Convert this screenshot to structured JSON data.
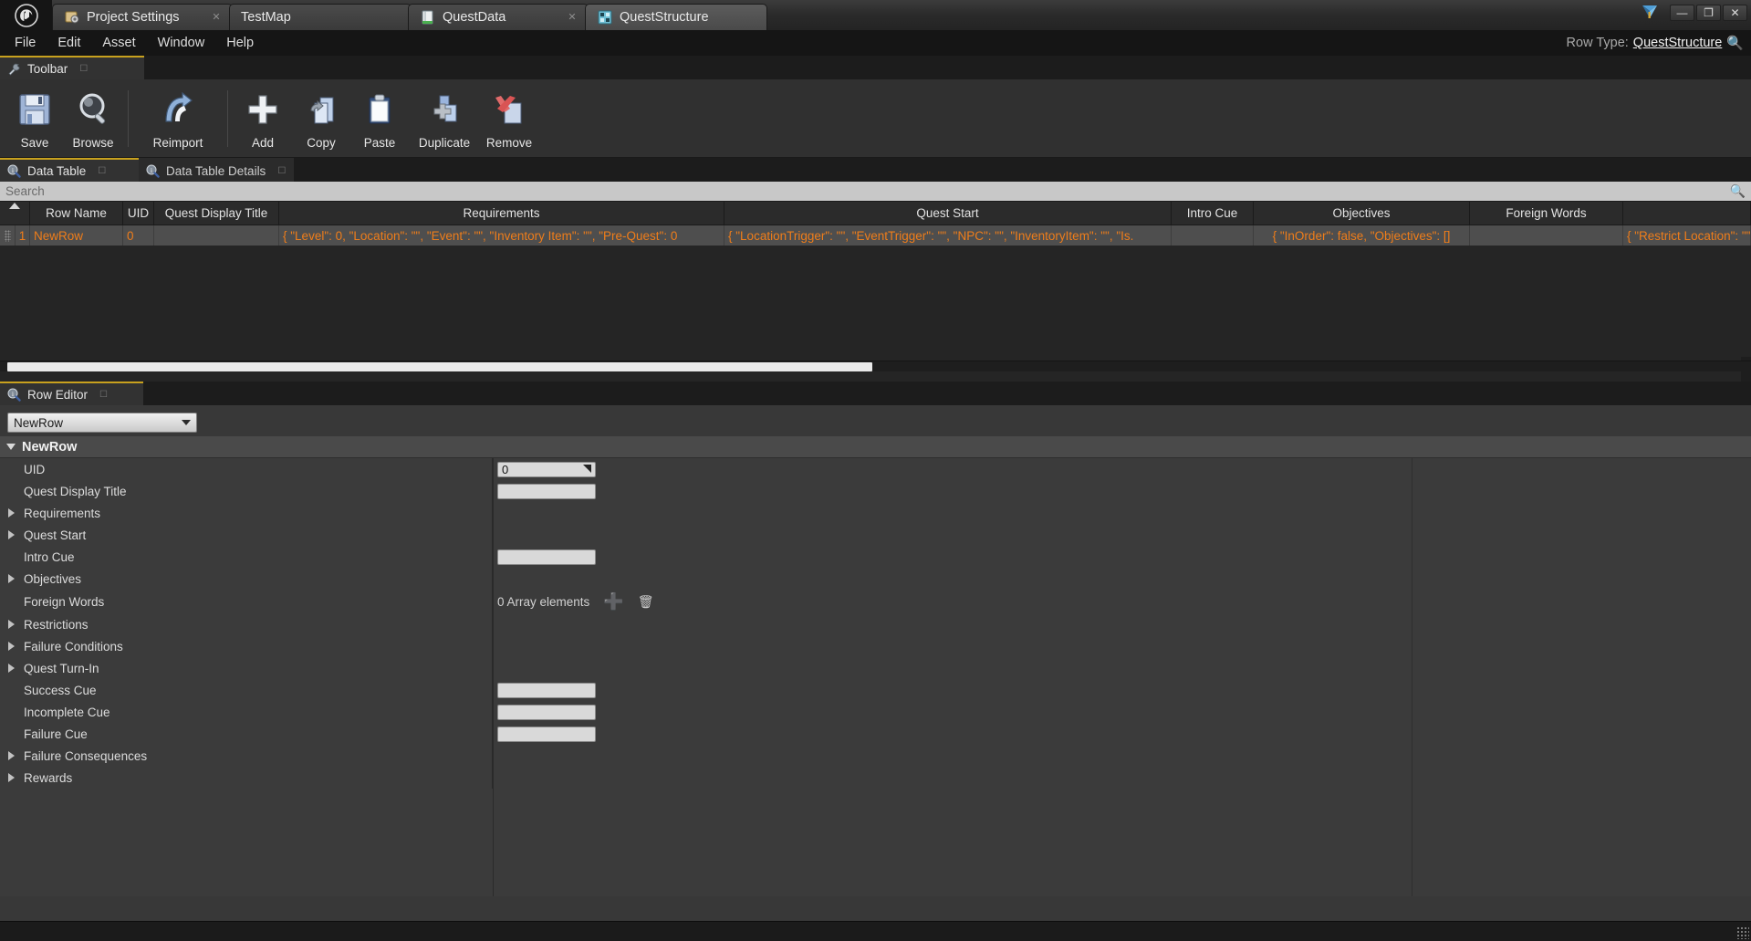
{
  "window": {
    "tabs": [
      {
        "label": "Project Settings",
        "icon": "gear-icon",
        "closable": true,
        "active": false
      },
      {
        "label": "TestMap",
        "icon": "none",
        "closable": false,
        "active": false
      },
      {
        "label": "QuestData",
        "icon": "datatable-icon",
        "closable": true,
        "active": false
      },
      {
        "label": "QuestStructure",
        "icon": "struct-icon",
        "closable": false,
        "active": true
      }
    ],
    "controls": {
      "minimize": "—",
      "maximize": "❐",
      "close": "✕"
    }
  },
  "menubar": {
    "items": [
      "File",
      "Edit",
      "Asset",
      "Window",
      "Help"
    ],
    "row_type_label": "Row Type:",
    "row_type_value": "QuestStructure"
  },
  "toolbar": {
    "tab_label": "Toolbar",
    "buttons": [
      {
        "label": "Save",
        "icon": "floppy-disk-icon"
      },
      {
        "label": "Browse",
        "icon": "magnifier-icon"
      },
      {
        "label": "Reimport",
        "icon": "reimport-arrow-icon"
      },
      {
        "label": "Add",
        "icon": "plus-icon"
      },
      {
        "label": "Copy",
        "icon": "copy-pages-icon"
      },
      {
        "label": "Paste",
        "icon": "clipboard-icon"
      },
      {
        "label": "Duplicate",
        "icon": "duplicate-icon"
      },
      {
        "label": "Remove",
        "icon": "remove-x-icon"
      }
    ]
  },
  "datatable": {
    "tabs": [
      {
        "label": "Data Table",
        "active": true
      },
      {
        "label": "Data Table Details",
        "active": false
      }
    ],
    "search": {
      "placeholder": "Search",
      "value": ""
    },
    "columns": [
      "Row Name",
      "UID",
      "Quest Display Title",
      "Requirements",
      "Quest Start",
      "Intro Cue",
      "Objectives",
      "Foreign Words"
    ],
    "rows": [
      {
        "index": "1",
        "row_name": "NewRow",
        "uid": "0",
        "quest_display_title": "",
        "requirements": "{ \"Level\": 0, \"Location\": \"\", \"Event\": \"\", \"Inventory Item\": \"\", \"Pre-Quest\": 0",
        "quest_start": "{ \"LocationTrigger\": \"\", \"EventTrigger\": \"\", \"NPC\": \"\", \"InventoryItem\": \"\", \"Is.",
        "intro_cue": "",
        "objectives": "{ \"InOrder\": false, \"Objectives\": []",
        "foreign_words": "",
        "overflow": "{ \"Restrict Location\": \"\", \"Restri"
      }
    ]
  },
  "row_editor": {
    "tab_label": "Row Editor",
    "selected_row": "NewRow",
    "category": "NewRow",
    "properties": [
      {
        "label": "UID",
        "expandable": false,
        "editor": "number",
        "value": "0"
      },
      {
        "label": "Quest Display Title",
        "expandable": false,
        "editor": "text",
        "value": ""
      },
      {
        "label": "Requirements",
        "expandable": true,
        "editor": "none",
        "value": ""
      },
      {
        "label": "Quest Start",
        "expandable": true,
        "editor": "none",
        "value": ""
      },
      {
        "label": "Intro Cue",
        "expandable": false,
        "editor": "text",
        "value": ""
      },
      {
        "label": "Objectives",
        "expandable": true,
        "editor": "none",
        "value": ""
      },
      {
        "label": "Foreign Words",
        "expandable": false,
        "editor": "array",
        "value": "0 Array elements"
      },
      {
        "label": "Restrictions",
        "expandable": true,
        "editor": "none",
        "value": ""
      },
      {
        "label": "Failure Conditions",
        "expandable": true,
        "editor": "none",
        "value": ""
      },
      {
        "label": "Quest Turn-In",
        "expandable": true,
        "editor": "none",
        "value": ""
      },
      {
        "label": "Success Cue",
        "expandable": false,
        "editor": "text",
        "value": ""
      },
      {
        "label": "Incomplete Cue",
        "expandable": false,
        "editor": "text",
        "value": ""
      },
      {
        "label": "Failure Cue",
        "expandable": false,
        "editor": "text",
        "value": ""
      },
      {
        "label": "Failure Consequences",
        "expandable": true,
        "editor": "none",
        "value": ""
      },
      {
        "label": "Rewards",
        "expandable": true,
        "editor": "none",
        "value": ""
      }
    ],
    "array_add_icon": "plus-icon",
    "array_delete_icon": "trash-icon"
  },
  "colors": {
    "row_text": "#ef7d1a",
    "tab_accent": "#c8a11e",
    "panel_bg": "#3b3b3b",
    "titlebar_bg": "#3c3c3c"
  }
}
